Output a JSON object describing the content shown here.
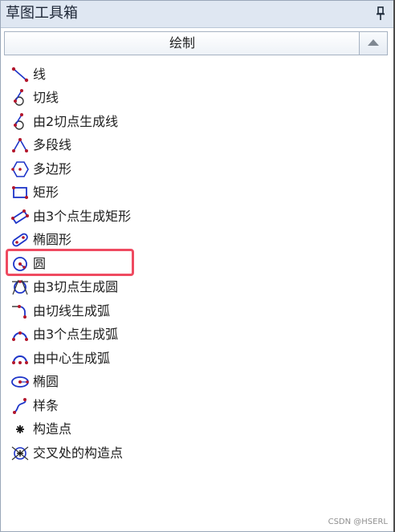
{
  "window": {
    "title": "草图工具箱",
    "pin_icon": "pin-icon"
  },
  "section": {
    "label": "绘制",
    "scroll_icon": "scroll-up-icon"
  },
  "tools": [
    {
      "label": "线",
      "icon": "line-icon"
    },
    {
      "label": "切线",
      "icon": "tangent-line-icon"
    },
    {
      "label": "由2切点生成线",
      "icon": "line-two-tangents-icon"
    },
    {
      "label": "多段线",
      "icon": "polyline-icon"
    },
    {
      "label": "多边形",
      "icon": "polygon-icon"
    },
    {
      "label": "矩形",
      "icon": "rectangle-icon"
    },
    {
      "label": "由3个点生成矩形",
      "icon": "rectangle-3pts-icon"
    },
    {
      "label": "椭圆形",
      "icon": "oblong-icon"
    },
    {
      "label": "圆",
      "icon": "circle-icon"
    },
    {
      "label": "由3切点生成圆",
      "icon": "circle-3tangents-icon"
    },
    {
      "label": "由切线生成弧",
      "icon": "arc-tangent-icon"
    },
    {
      "label": "由3个点生成弧",
      "icon": "arc-3pts-icon"
    },
    {
      "label": "由中心生成弧",
      "icon": "arc-center-icon"
    },
    {
      "label": "椭圆",
      "icon": "ellipse-icon"
    },
    {
      "label": "样条",
      "icon": "spline-icon"
    },
    {
      "label": "构造点",
      "icon": "construction-point-icon"
    },
    {
      "label": "交叉处的构造点",
      "icon": "intersection-point-icon"
    }
  ],
  "highlighted_tool": "圆",
  "colors": {
    "title_bar": "#dfe7f2",
    "highlight": "#ef4a60",
    "icon_red": "#b3162c",
    "icon_blue": "#1d34c8"
  },
  "watermark": "CSDN @HSERL"
}
